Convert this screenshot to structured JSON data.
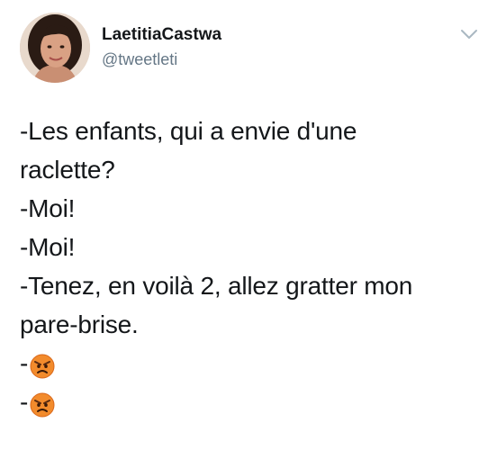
{
  "user": {
    "display_name": "LaetitiaCastwa",
    "handle": "@tweetleti"
  },
  "tweet": {
    "lines": [
      "-Les enfants, qui a envie d'une",
      "raclette?",
      "-Moi!",
      "-Moi!",
      "-Tenez, en voilà 2, allez gratter mon",
      "pare-brise."
    ],
    "emoji_lines": [
      {
        "prefix": "-",
        "emoji": "angry-face-icon"
      },
      {
        "prefix": "-",
        "emoji": "angry-face-icon"
      }
    ]
  },
  "colors": {
    "text": "#14171a",
    "secondary_text": "#657786",
    "caret": "#aab8c2",
    "emoji_face": "#f28b2c"
  }
}
